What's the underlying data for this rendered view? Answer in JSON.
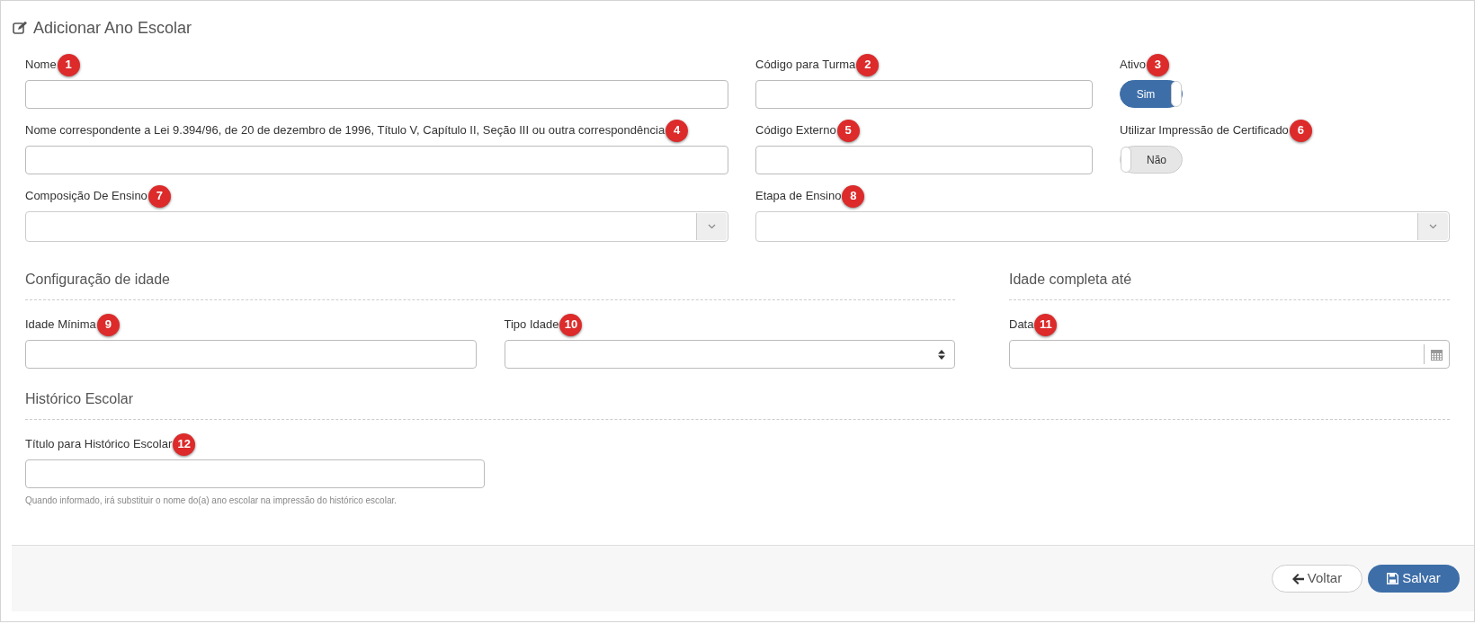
{
  "page_title": "Adicionar Ano Escolar",
  "main_fields": [
    {
      "kind": "text",
      "label": "Nome",
      "badge": "1"
    },
    {
      "kind": "text",
      "label": "Código para Turma",
      "badge": "2"
    },
    {
      "kind": "toggle",
      "label": "Ativo",
      "badge": "3",
      "on": true,
      "text": "Sim"
    },
    {
      "kind": "text",
      "label": "Nome correspondente a Lei 9.394/96, de 20 de dezembro de 1996, Título V, Capítulo II, Seção III ou outra correspondência",
      "badge": "4"
    },
    {
      "kind": "text",
      "label": "Código Externo",
      "badge": "5"
    },
    {
      "kind": "toggle",
      "label": "Utilizar Impressão de Certificado",
      "badge": "6",
      "on": false,
      "text": "Não"
    },
    {
      "kind": "select",
      "label": "Composição De Ensino",
      "badge": "7"
    },
    {
      "kind": "select",
      "label": "Etapa de Ensino",
      "badge": "8"
    }
  ],
  "age_config": {
    "title": "Configuração de idade",
    "fields": [
      {
        "kind": "text",
        "label": "Idade Mínima",
        "badge": "9"
      },
      {
        "kind": "spinner",
        "label": "Tipo Idade",
        "badge": "10"
      }
    ]
  },
  "age_until": {
    "title": "Idade completa até",
    "fields": [
      {
        "kind": "date",
        "label": "Data",
        "badge": "11"
      }
    ]
  },
  "history": {
    "title": "Histórico Escolar",
    "fields": [
      {
        "kind": "text",
        "label": "Título para Histórico Escolar",
        "badge": "12",
        "help": "Quando informado, irá substituir o nome do(a) ano escolar na impressão do histórico escolar."
      }
    ]
  },
  "buttons": [
    {
      "kind": "secondary",
      "label": "Voltar"
    },
    {
      "kind": "primary",
      "label": "Salvar"
    }
  ]
}
